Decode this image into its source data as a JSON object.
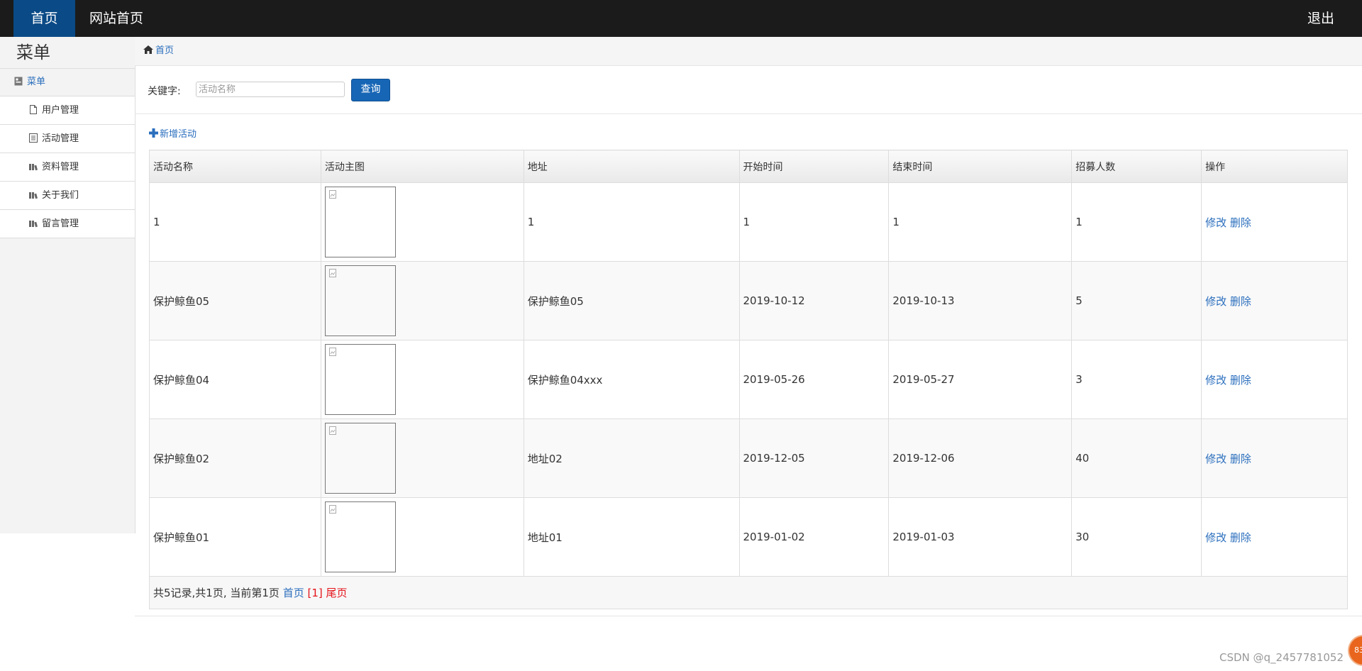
{
  "navbar": {
    "home": "首页",
    "site_home": "网站首页",
    "logout": "退出"
  },
  "sidebar": {
    "title": "菜单",
    "root": "菜单",
    "items": [
      {
        "label": "用户管理",
        "icon": "file-icon"
      },
      {
        "label": "活动管理",
        "icon": "list-icon"
      },
      {
        "label": "资料管理",
        "icon": "books-icon"
      },
      {
        "label": "关于我们",
        "icon": "books-icon"
      },
      {
        "label": "留言管理",
        "icon": "books-icon"
      }
    ]
  },
  "breadcrumb": {
    "home": "首页",
    "icon": "home-icon"
  },
  "search": {
    "label": "关键字:",
    "placeholder": "活动名称",
    "value": "",
    "button": "查询"
  },
  "add_activity": "新增活动",
  "table": {
    "headers": [
      "活动名称",
      "活动主图",
      "地址",
      "开始时间",
      "结束时间",
      "招募人数",
      "操作"
    ],
    "rows": [
      {
        "name": "1",
        "address": "1",
        "start": "1",
        "end": "1",
        "count": "1"
      },
      {
        "name": "保护鲸鱼05",
        "address": "保护鲸鱼05",
        "start": "2019-10-12",
        "end": "2019-10-13",
        "count": "5"
      },
      {
        "name": "保护鲸鱼04",
        "address": "保护鲸鱼04xxx",
        "start": "2019-05-26",
        "end": "2019-05-27",
        "count": "3"
      },
      {
        "name": "保护鲸鱼02",
        "address": "地址02",
        "start": "2019-12-05",
        "end": "2019-12-06",
        "count": "40"
      },
      {
        "name": "保护鲸鱼01",
        "address": "地址01",
        "start": "2019-01-02",
        "end": "2019-01-03",
        "count": "30"
      }
    ],
    "edit": "修改",
    "delete": "删除"
  },
  "pager": {
    "summary": "共5记录,共1页, 当前第1页",
    "first": "首页",
    "current": "[1]",
    "last": "尾页"
  },
  "watermark": "CSDN @q_2457781052",
  "badge": "83",
  "colors": {
    "navbar_bg": "#1b1b1b",
    "nav_active": "#0a4a86",
    "link": "#2a6ebd",
    "button": "#1766b6",
    "pager_red": "#e5141b"
  }
}
